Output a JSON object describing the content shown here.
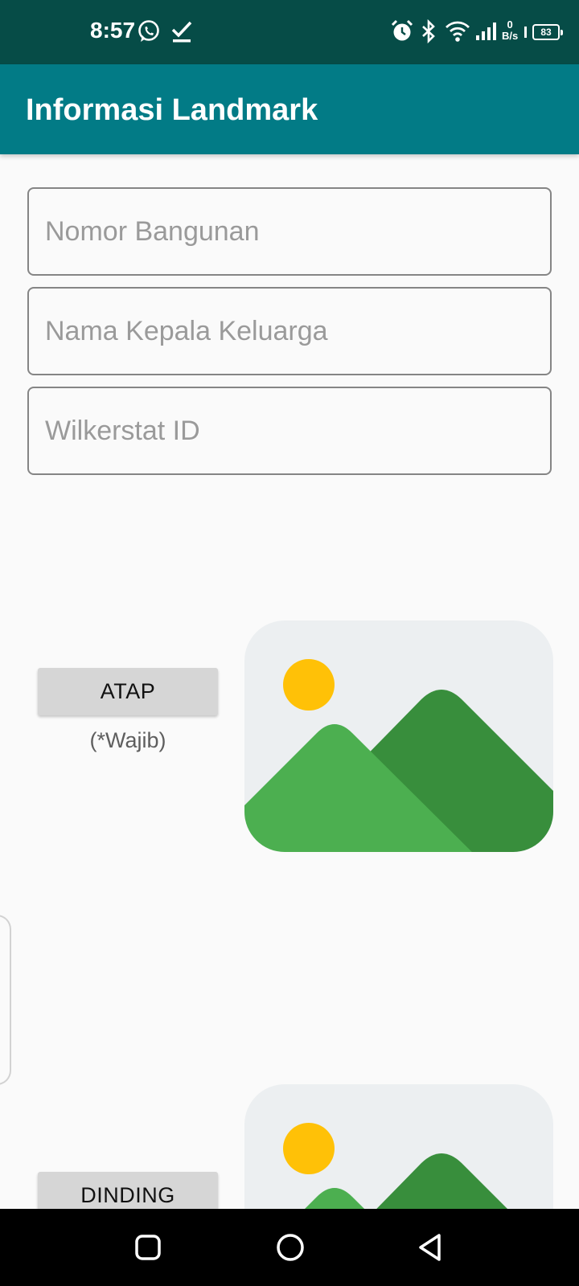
{
  "status_bar": {
    "time": "8:57",
    "net_speed_value": "0",
    "net_speed_unit": "B/s",
    "battery": "83",
    "icons": [
      "whatsapp-icon",
      "download-done-icon",
      "alarm-icon",
      "bluetooth-icon",
      "wifi-icon",
      "signal-icon",
      "battery-icon"
    ]
  },
  "app_bar": {
    "title": "Informasi Landmark"
  },
  "form": {
    "nomor_bangunan": {
      "placeholder": "Nomor Bangunan",
      "value": ""
    },
    "nama_kepala_keluarga": {
      "placeholder": "Nama Kepala Keluarga",
      "value": ""
    },
    "wilkerstat_id": {
      "placeholder": "Wilkerstat ID",
      "value": ""
    }
  },
  "photos": [
    {
      "button_label": "ATAP",
      "note": "(*Wajib)",
      "thumbnail_icon": "image-placeholder-icon"
    },
    {
      "button_label": "DINDING",
      "thumbnail_icon": "image-placeholder-icon"
    }
  ],
  "nav_bar": {
    "icons": [
      "recent-apps-icon",
      "home-icon",
      "back-icon"
    ]
  },
  "colors": {
    "status_bar": "#064c47",
    "app_bar": "#027b86",
    "sun": "#ffc107",
    "mountain_front": "#4caf50",
    "mountain_back": "#388e3c",
    "thumb_bg": "#eceff1"
  }
}
